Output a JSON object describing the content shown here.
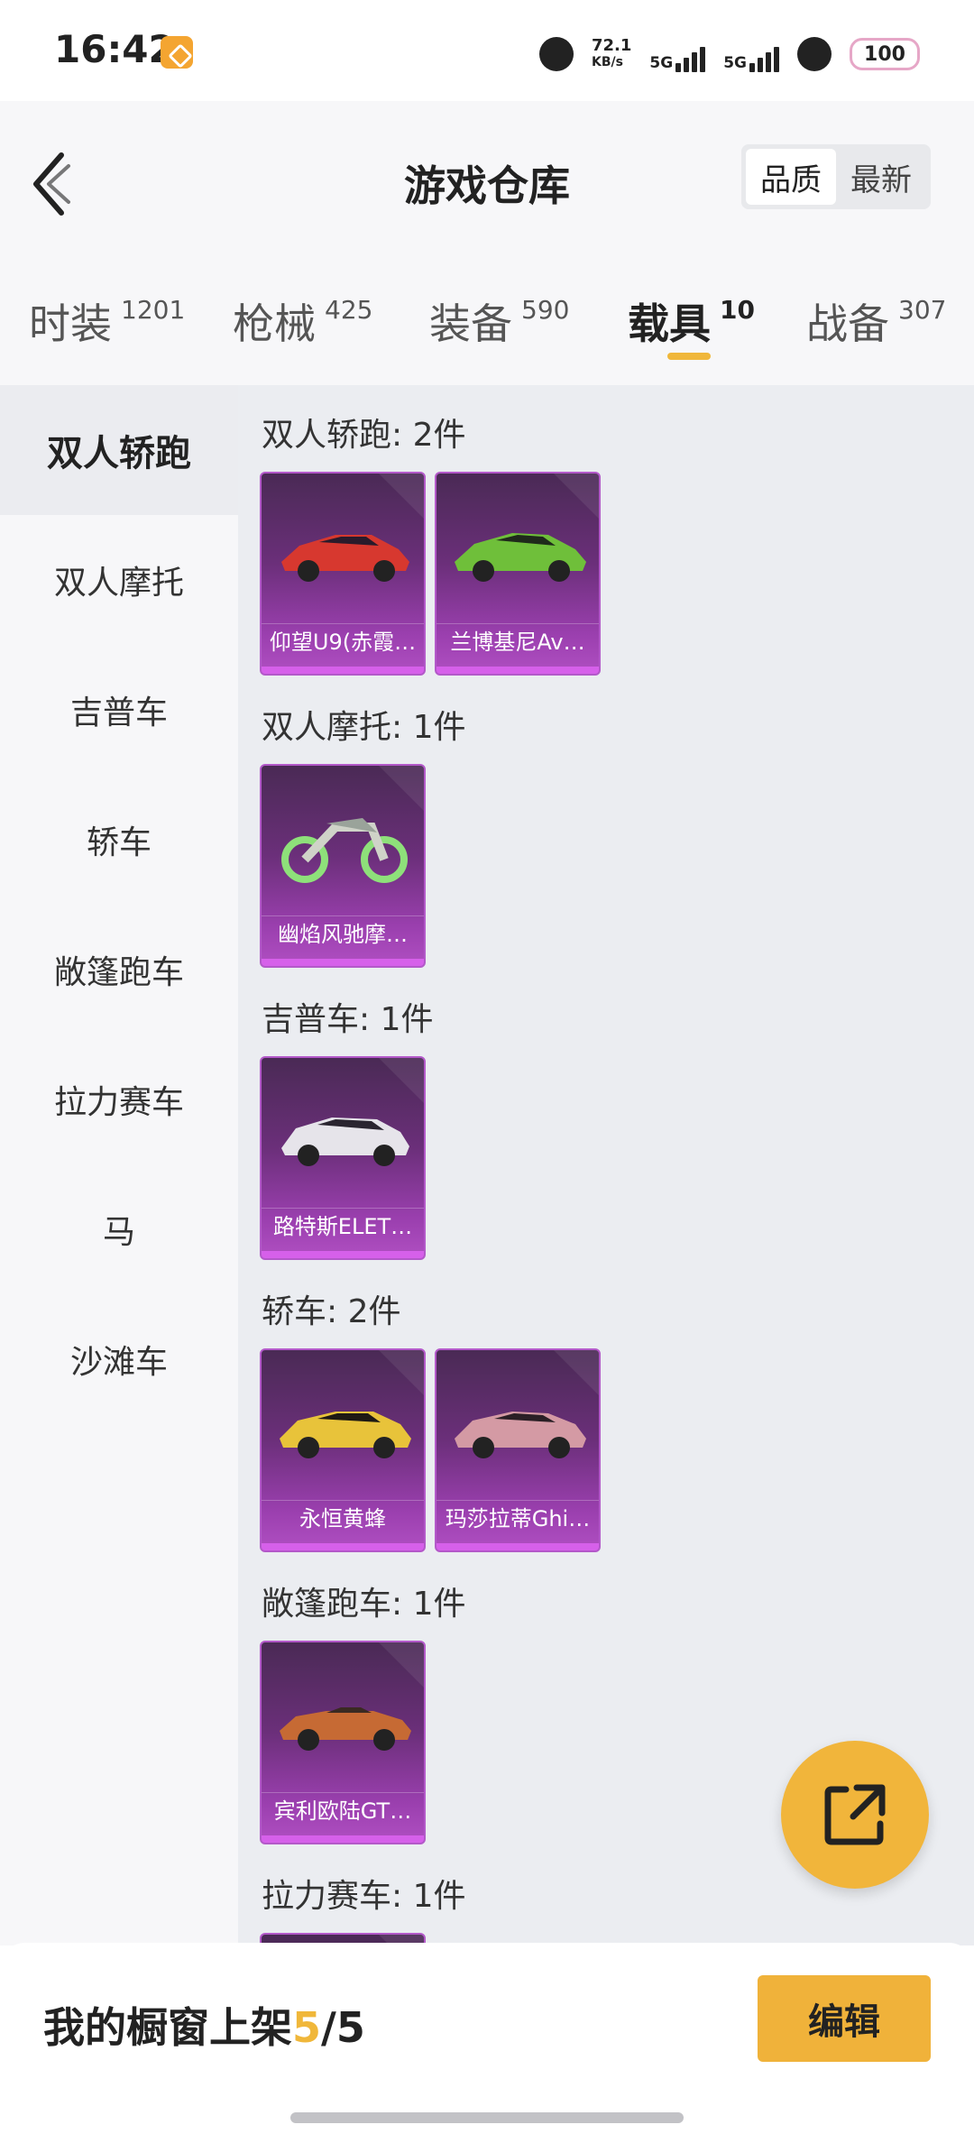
{
  "status": {
    "time": "16:42",
    "speed": "72.1",
    "speed_unit": "KB/s",
    "net1": "5G",
    "net2": "5G",
    "battery": "100"
  },
  "header": {
    "title": "游戏仓库",
    "sort_quality": "品质",
    "sort_latest": "最新"
  },
  "tabs": [
    {
      "label": "时装",
      "count": "1201"
    },
    {
      "label": "枪械",
      "count": "425"
    },
    {
      "label": "装备",
      "count": "590"
    },
    {
      "label": "载具",
      "count": "10"
    },
    {
      "label": "战备",
      "count": "307"
    }
  ],
  "sidebar": [
    "双人轿跑",
    "双人摩托",
    "吉普车",
    "轿车",
    "敞篷跑车",
    "拉力赛车",
    "马",
    "沙滩车"
  ],
  "sections": [
    {
      "title": "双人轿跑: 2件",
      "items": [
        "仰望U9(赤霞…",
        "兰博基尼Av…"
      ]
    },
    {
      "title": "双人摩托: 1件",
      "items": [
        "幽焰风驰摩…"
      ]
    },
    {
      "title": "吉普车: 1件",
      "items": [
        "路特斯ELET…"
      ]
    },
    {
      "title": "轿车: 2件",
      "items": [
        "永恒黄蜂",
        "玛莎拉蒂Ghi…"
      ]
    },
    {
      "title": "敞篷跑车: 1件",
      "items": [
        "宾利欧陆GT…"
      ]
    },
    {
      "title": "拉力赛车: 1件",
      "items": []
    }
  ],
  "bottom": {
    "shelf_label": "我的橱窗上架",
    "shelf_count": "5",
    "shelf_total": "/5",
    "edit": "编辑"
  },
  "colors": {
    "accent": "#f0b23a",
    "card_purple": "#9a3fae"
  },
  "icons": [
    "back-chevron-icon",
    "share-export-icon"
  ]
}
